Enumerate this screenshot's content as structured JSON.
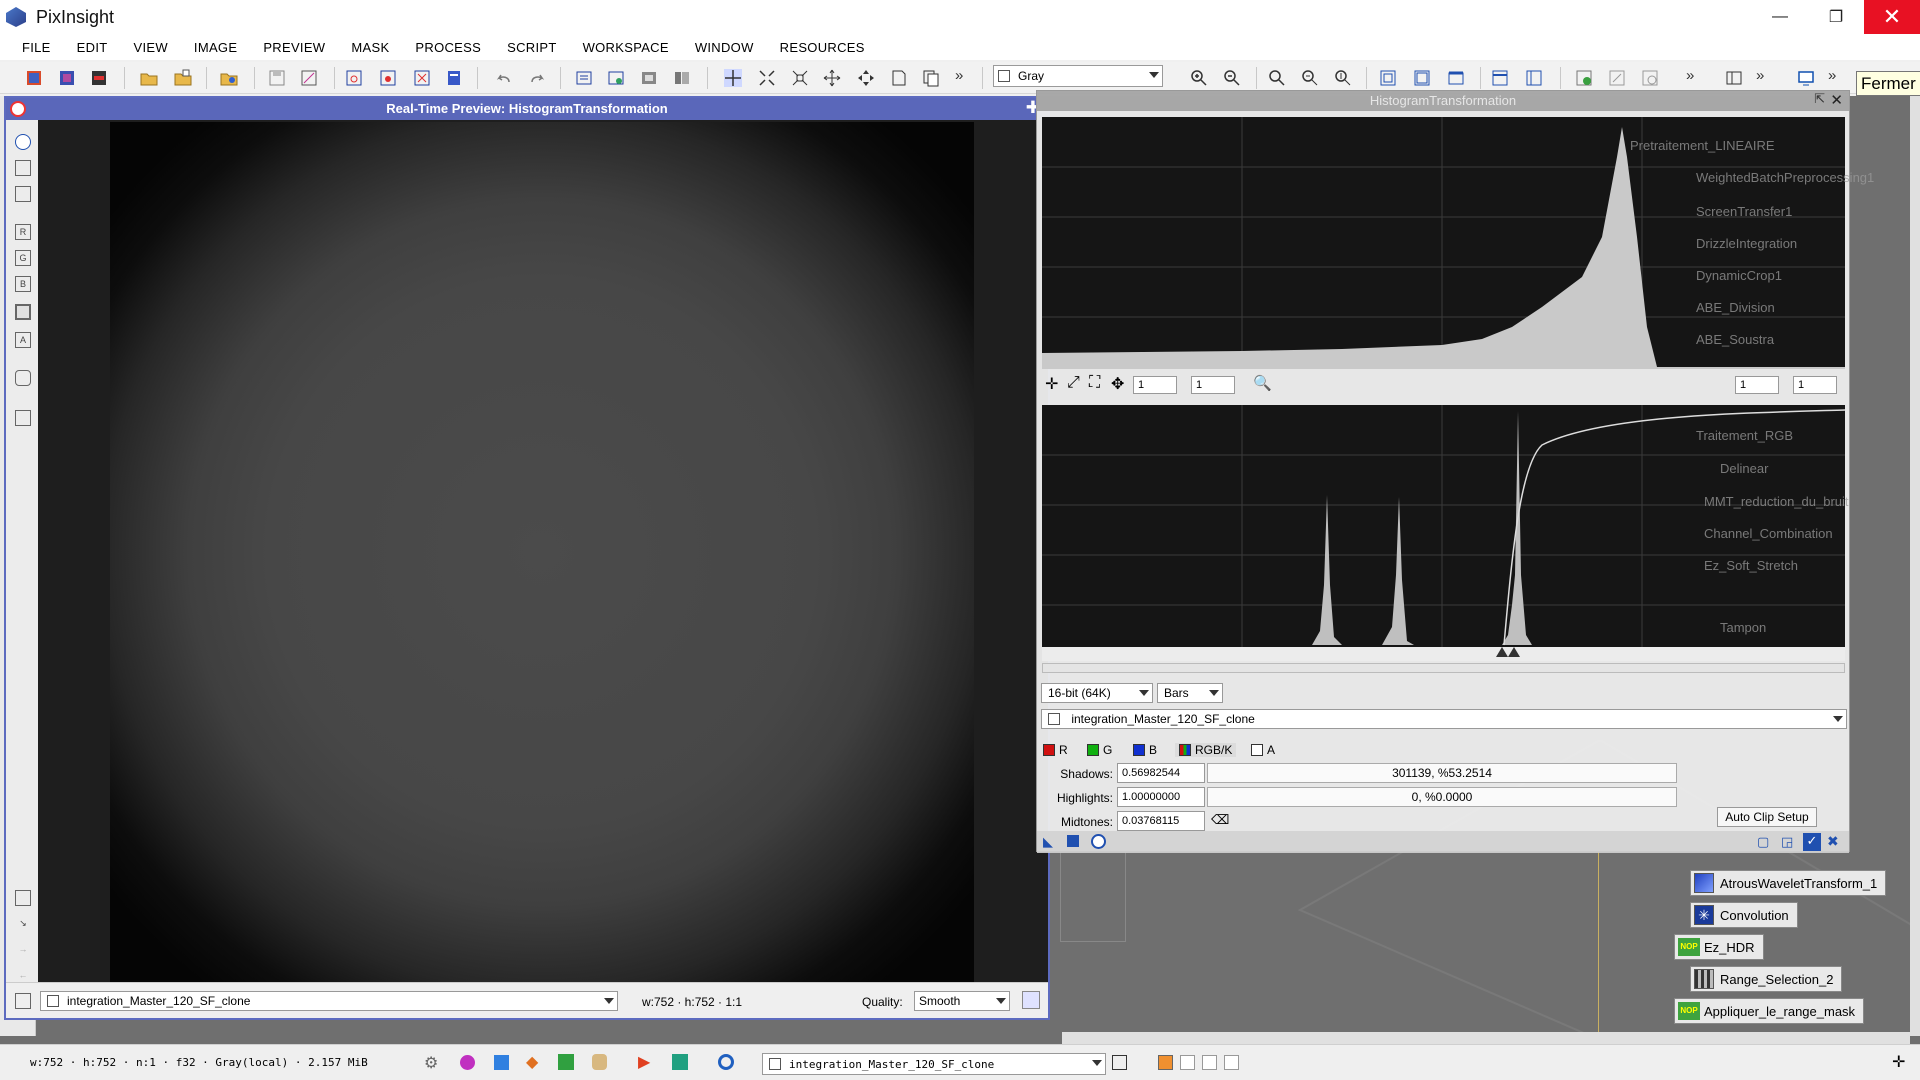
{
  "app": {
    "title": "PixInsight",
    "logo_icon": "pixinsight-logo-icon"
  },
  "window_controls": {
    "minimize": "—",
    "restore": "❐",
    "close": "✕"
  },
  "tooltip": {
    "text": "Fermer"
  },
  "menu": {
    "items": [
      "FILE",
      "EDIT",
      "VIEW",
      "IMAGE",
      "PREVIEW",
      "MASK",
      "PROCESS",
      "SCRIPT",
      "WORKSPACE",
      "WINDOW",
      "RESOURCES"
    ]
  },
  "toolbar": {
    "view_selector_value": "Gray",
    "more_glyph": "»"
  },
  "preview_window": {
    "title": "Real-Time Preview: HistogramTransformation",
    "pin_glyph": "✚",
    "view_selector": "integration_Master_120_SF_clone",
    "dimensions": "w:752 · h:752 · 1:1",
    "quality_label": "Quality:",
    "quality_value": "Smooth"
  },
  "histogram_window": {
    "title": "HistogramTransformation",
    "close_glyph": "✕",
    "pin_glyph": "⇱",
    "upper_zoom_h": "1",
    "upper_zoom_v": "1",
    "lower_zoom_h": "1",
    "lower_zoom_v": "1",
    "bit_depth": "16-bit (64K)",
    "graph_style": "Bars",
    "image_selector": "integration_Master_120_SF_clone",
    "channels": [
      {
        "label": "R",
        "color": "#d01010"
      },
      {
        "label": "G",
        "color": "#10b010"
      },
      {
        "label": "B",
        "color": "#1030d0"
      },
      {
        "label": "RGB/K",
        "color": "#6a6a6a"
      },
      {
        "label": "A",
        "color": "#ffffff"
      }
    ],
    "shadows_label": "Shadows:",
    "shadows_value": "0.56982544",
    "shadows_clip": "301139, %53.2514",
    "highlights_label": "Highlights:",
    "highlights_value": "1.00000000",
    "highlights_clip": "0, %0.0000",
    "midtones_label": "Midtones:",
    "midtones_value": "0.03768115",
    "auto_clip_label": "Auto Clip Setup"
  },
  "process_icons": [
    {
      "label": "AtrousWaveletTransform_1",
      "icon": "wavelet-icon"
    },
    {
      "label": "Convolution",
      "icon": "convolution-icon"
    },
    {
      "label": "Ez_HDR",
      "icon": "nop-icon"
    },
    {
      "label": "Range_Selection_2",
      "icon": "range-selection-icon"
    },
    {
      "label": "Appliquer_le_range_mask",
      "icon": "nop-icon"
    }
  ],
  "ghost_process_icons": [
    "Pretraitement_LINEAIRE",
    "WeightedBatchPreprocessing1",
    "ScreenTransfer1",
    "DrizzleIntegration",
    "DynamicCrop1",
    "ABE_Division",
    "ABE_Soustra",
    "Traitement_RGB",
    "Delinear",
    "MMT_reduction_du_bruit",
    "Channel_Combination",
    "Ez_Soft_Stretch",
    "Tampon"
  ],
  "statusbar": {
    "info": "w:752 · h:752 · n:1 · f32 · Gray(local) · 2.157 MiB",
    "view_selector": "integration_Master_120_SF_clone"
  },
  "colors": {
    "preview_title_bg": "#5a67ba",
    "close_red": "#e81123",
    "workspace": "#6f6f6f"
  }
}
